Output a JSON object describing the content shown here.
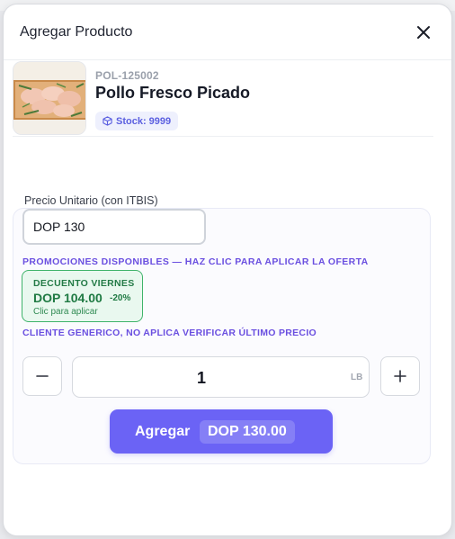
{
  "modal": {
    "title": "Agregar Producto"
  },
  "product": {
    "code": "POL-125002",
    "name": "Pollo Fresco Picado",
    "stock_label": "Stock: 9999",
    "icon": "box-icon"
  },
  "pricing": {
    "label": "Precio Unitario (con ITBIS)",
    "value": "DOP 130"
  },
  "promotions": {
    "heading": "PROMOCIONES DISPONIBLES — HAZ CLIC PARA APLICAR LA OFERTA",
    "items": [
      {
        "name": "DECUENTO VIERNES",
        "price": "DOP 104.00",
        "discount": "-20%",
        "hint": "Clic para aplicar"
      }
    ],
    "client_note": "CLIENTE GENERICO, NO APLICA VERIFICAR ÚLTIMO PRECIO"
  },
  "quantity": {
    "value": "1",
    "unit": "LB"
  },
  "add_button": {
    "label": "Agregar",
    "total": "DOP 130.00"
  },
  "colors": {
    "accent": "#6b63f5",
    "promo_green": "#3fb36a",
    "note_purple": "#6a4fe0"
  }
}
